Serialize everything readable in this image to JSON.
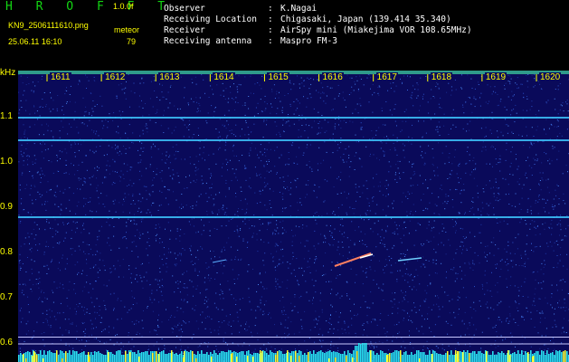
{
  "app": {
    "brand": "H R O F F T",
    "version": "1.0.0f",
    "filename": "KN9_2506111610.png",
    "mode_label": "meteor",
    "datetime": "25.06.11 16:10",
    "count": "79"
  },
  "info": [
    {
      "label": "Observer",
      "sep": ":",
      "value": "K.Nagai"
    },
    {
      "label": "Receiving Location",
      "sep": ":",
      "value": "Chigasaki, Japan (139.414 35.340)"
    },
    {
      "label": "Receiver",
      "sep": ":",
      "value": "AirSpy mini (Miakejima VOR 108.65MHz)"
    },
    {
      "label": "Receiving antenna",
      "sep": ":",
      "value": "Maspro FM-3"
    }
  ],
  "chart_data": {
    "type": "heatmap",
    "ylabel": "kHz",
    "y_ticks": [
      "1.1",
      "1.0",
      "0.9",
      "0.8",
      "0.7",
      "0.6"
    ],
    "x_ticks": [
      "1611",
      "1612",
      "1613",
      "1614",
      "1615",
      "1616",
      "1617",
      "1618",
      "1619",
      "1620"
    ],
    "ylim": [
      0.58,
      1.2
    ],
    "horizontal_lines_khz": [
      1.1,
      1.05,
      0.88
    ],
    "reference_lines_khz": [
      0.615,
      0.6
    ],
    "colors": {
      "background": "#0a0a5a",
      "line": "#3ec8ff",
      "meteor": "#ff8060",
      "axis_text": "#ffff00"
    }
  }
}
